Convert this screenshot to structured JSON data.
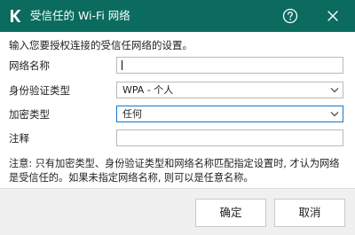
{
  "titlebar": {
    "title": "受信任的 Wi-Fi 网络",
    "background": "#0b6b5f",
    "app_icon": "kaspersky-k-icon",
    "help_icon": "help-circle-icon",
    "close_icon": "close-icon"
  },
  "intro_text": "输入您要授权连接的受信任网络的设置。",
  "form": {
    "network_name": {
      "label": "网络名称",
      "value": ""
    },
    "auth_type": {
      "label": "身份验证类型",
      "value": "WPA - 个人"
    },
    "encryption_type": {
      "label": "加密类型",
      "value": "任何"
    },
    "comment": {
      "label": "注释",
      "value": ""
    }
  },
  "note": "注意: 只有加密类型、身份验证类型和网络名称匹配指定设置时, 才认为网络是受信任的。如果未指定网络名称, 则可以是任意名称。",
  "buttons": {
    "ok": "确定",
    "cancel": "取消"
  },
  "colors": {
    "focus_border": "#1676c8",
    "footer_bg": "#f0f0f0"
  }
}
